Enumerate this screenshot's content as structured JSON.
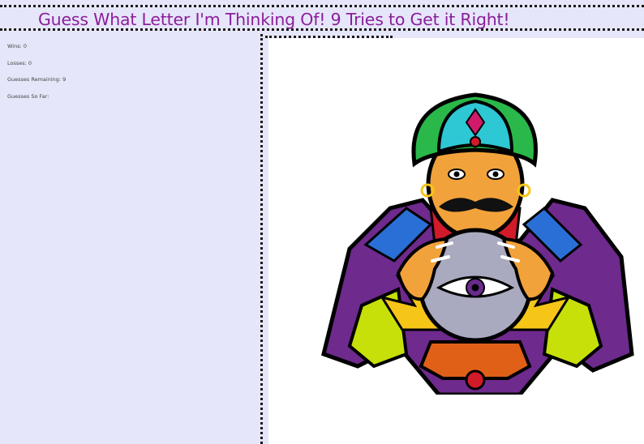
{
  "header": {
    "title": "Guess What Letter I'm Thinking Of! 9 Tries to Get it Right!"
  },
  "stats": {
    "wins_label": "Wins:",
    "wins": "0",
    "losses_label": "Losses:",
    "losses": "0",
    "remaining_label": "Guesses Remaining:",
    "remaining": "9",
    "guesses_label": "Guesses So Far:",
    "guesses": ""
  },
  "image": {
    "icon": "fortune-teller-crystal-ball-illustration"
  },
  "colors": {
    "title": "#8b1e9a",
    "background": "#e6e6fa",
    "panel": "#ffffff",
    "border": "#1a1a1a"
  }
}
